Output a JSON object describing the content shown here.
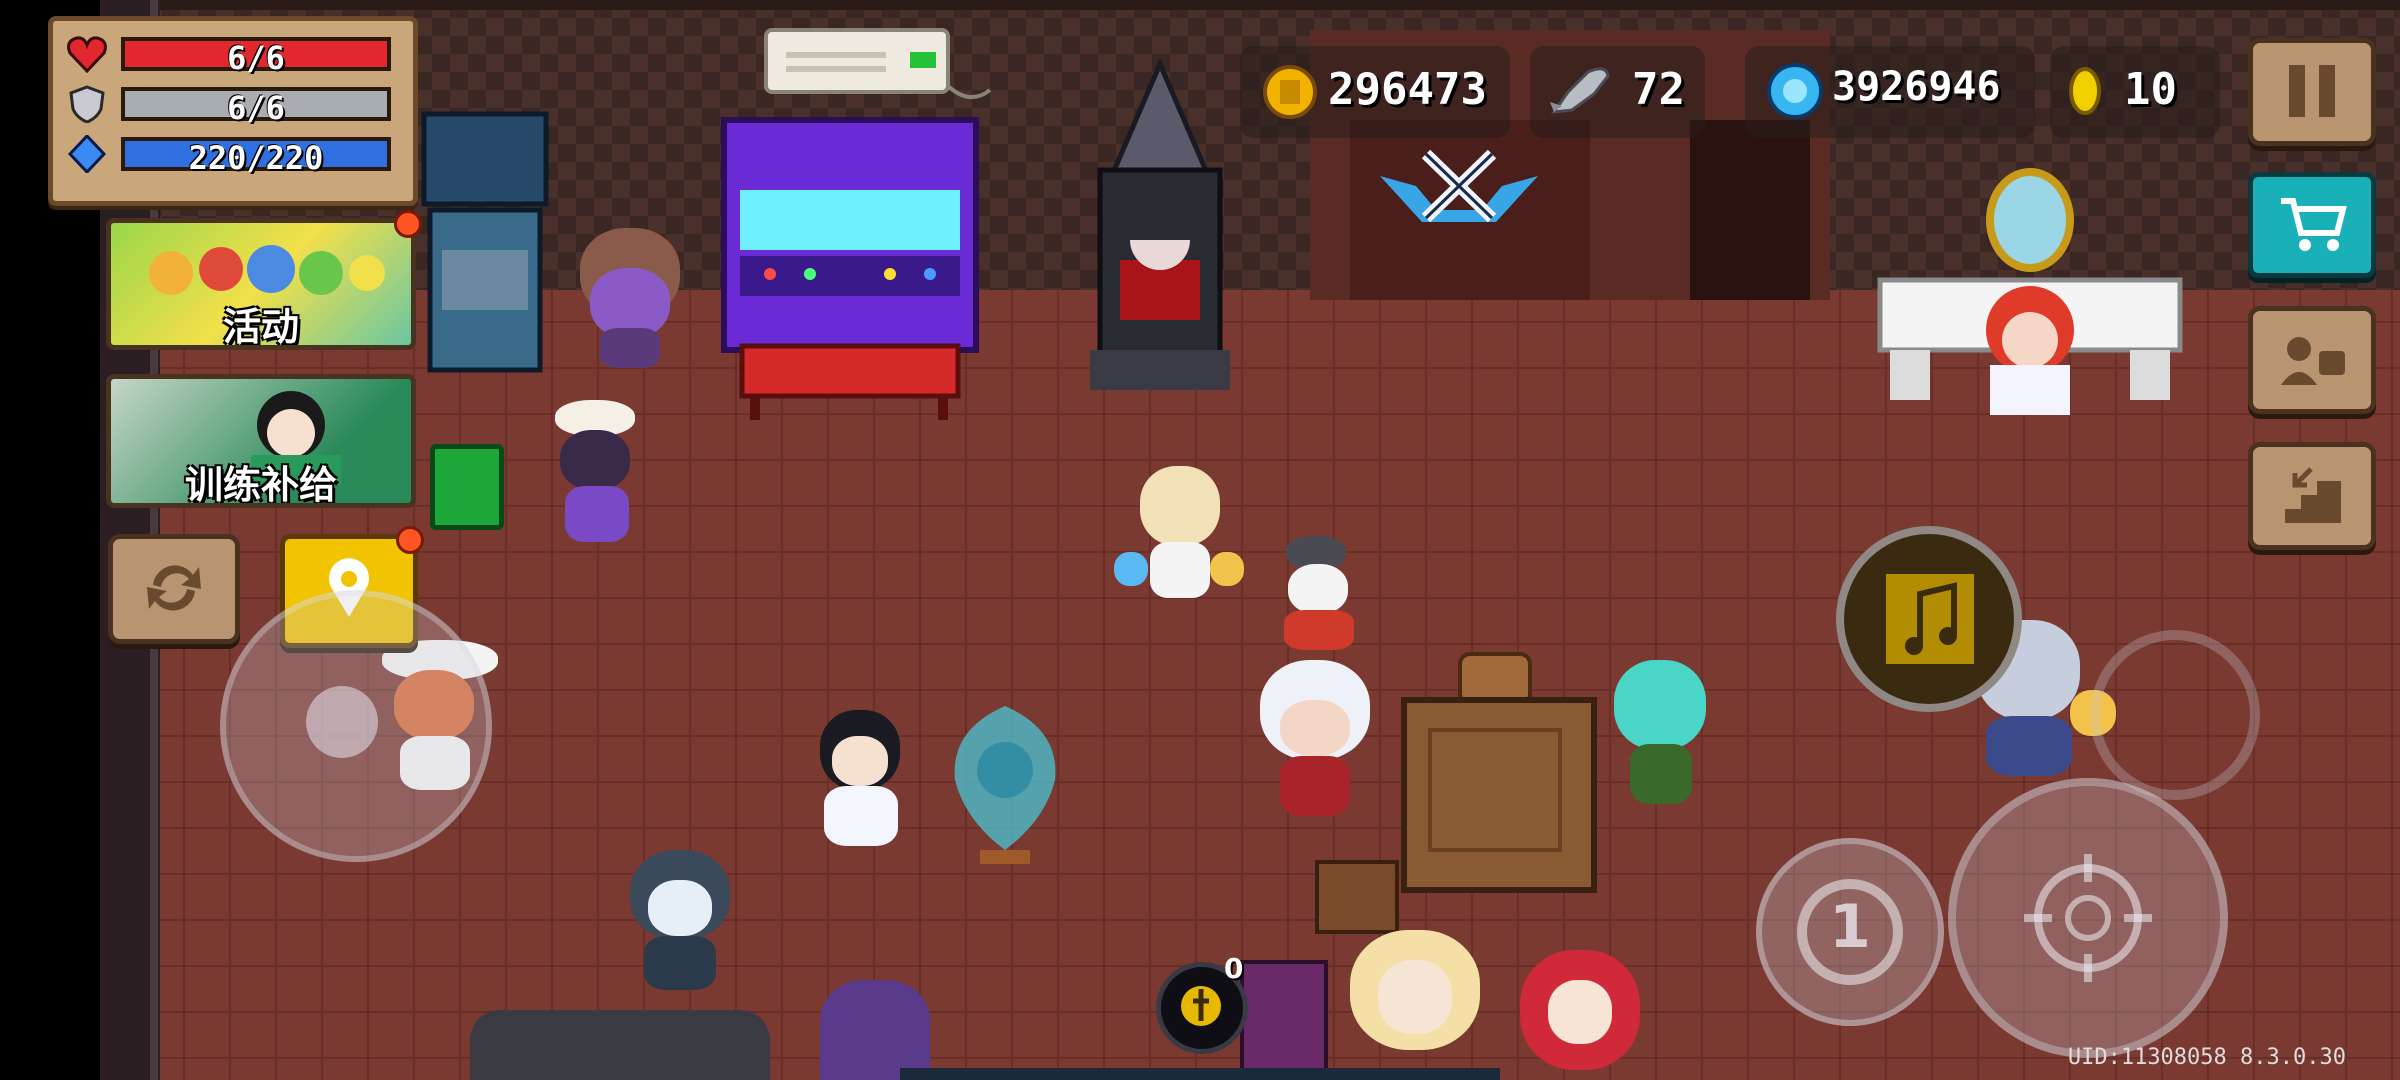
{
  "hud": {
    "health": {
      "text": "6/6",
      "current": 6,
      "max": 6,
      "color": "#e0282e"
    },
    "armor": {
      "text": "6/6",
      "current": 6,
      "max": 6,
      "color": "#a9acb0"
    },
    "energy": {
      "text": "220/220",
      "current": 220,
      "max": 220,
      "color": "#2f6fe0"
    }
  },
  "currencies": {
    "gold": {
      "value": "296473",
      "icon": "gold-coin-icon"
    },
    "fish": {
      "value": "72",
      "icon": "fish-icon"
    },
    "gems": {
      "value": "3926946",
      "icon": "blue-gem-icon"
    },
    "tokens": {
      "value": "10",
      "icon": "gold-token-icon"
    }
  },
  "left_menu": {
    "event_label": "活动",
    "training_label": "训练补给"
  },
  "controls": {
    "skill_count": "1",
    "music_badge": "0"
  },
  "footer": {
    "uid": "UID:11308058 8.3.0.30"
  },
  "icons": {
    "pause": "pause-icon",
    "shop": "shopping-cart-icon",
    "profile": "profile-card-icon",
    "exit": "stairs-exit-icon",
    "swap": "swap-cycle-icon",
    "location": "location-pin-icon",
    "attack": "crosshair-icon",
    "pvp": "crossed-swords-icon"
  },
  "colors": {
    "floor": "#7a3a32",
    "wall": "#3a2622",
    "accent_gold": "#f2c300",
    "shop_teal": "#1ab0b8"
  }
}
